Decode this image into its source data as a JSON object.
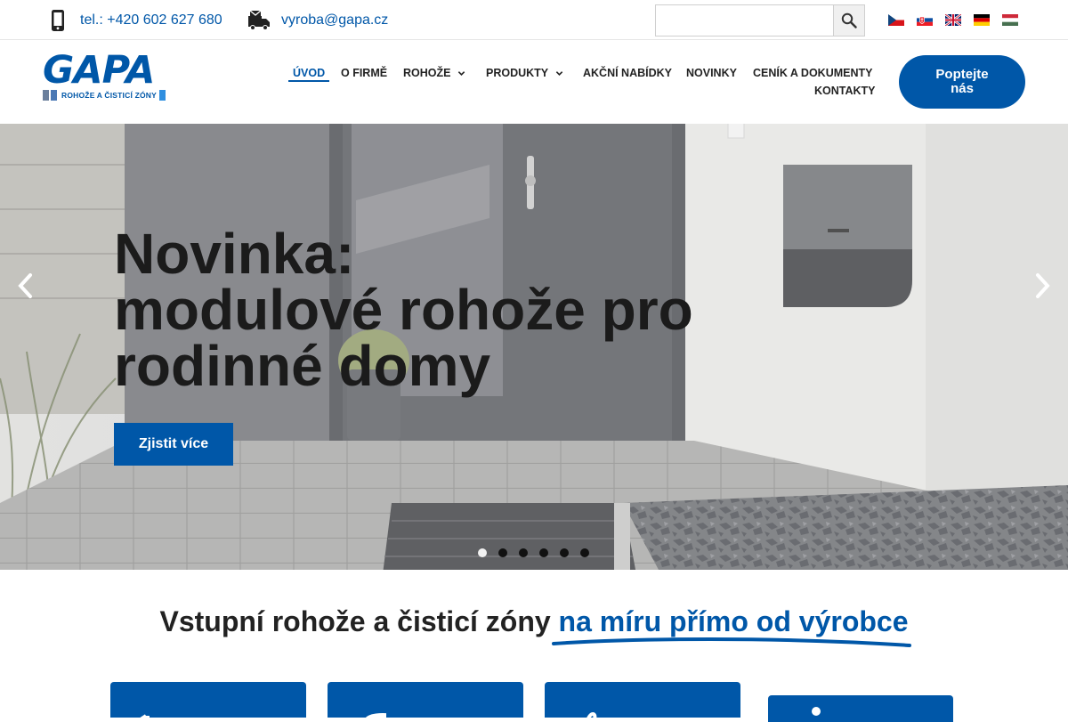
{
  "topbar": {
    "phone_text": "tel.: +420 602 627 680",
    "email_text": "vyroba@gapa.cz",
    "search_placeholder": "",
    "icons": {
      "phone": "mobile-phone-icon",
      "email": "mail-truck-icon",
      "search": "search-icon"
    },
    "languages": [
      "cz",
      "sk",
      "en",
      "de",
      "hu"
    ]
  },
  "header": {
    "logo_word": "GAPA",
    "logo_tagline": "ROHOŽE A ČISTICÍ ZÓNY",
    "nav": [
      {
        "label": "Úvod",
        "active": true
      },
      {
        "label": "O firmě"
      },
      {
        "label": "Rohože",
        "dropdown": true
      },
      {
        "label": "Produkty",
        "dropdown": true
      },
      {
        "label": "Akční nabídky"
      },
      {
        "label": "Novinky"
      },
      {
        "label": "Ceník a dokumenty"
      },
      {
        "label": "Kontakty"
      }
    ],
    "cta_label": "Poptejte nás"
  },
  "hero": {
    "title_lines": [
      "Novinka:",
      "modulové rohože pro",
      "rodinné domy"
    ],
    "button_label": "Zjistit více",
    "slides_count": 6,
    "active_slide": 1
  },
  "section": {
    "title_plain": "Vstupní rohože a čisticí zóny ",
    "title_highlight": "na míru přímo od výrobce"
  },
  "colors": {
    "brand_blue": "#0057a8",
    "text_dark": "#222222"
  }
}
